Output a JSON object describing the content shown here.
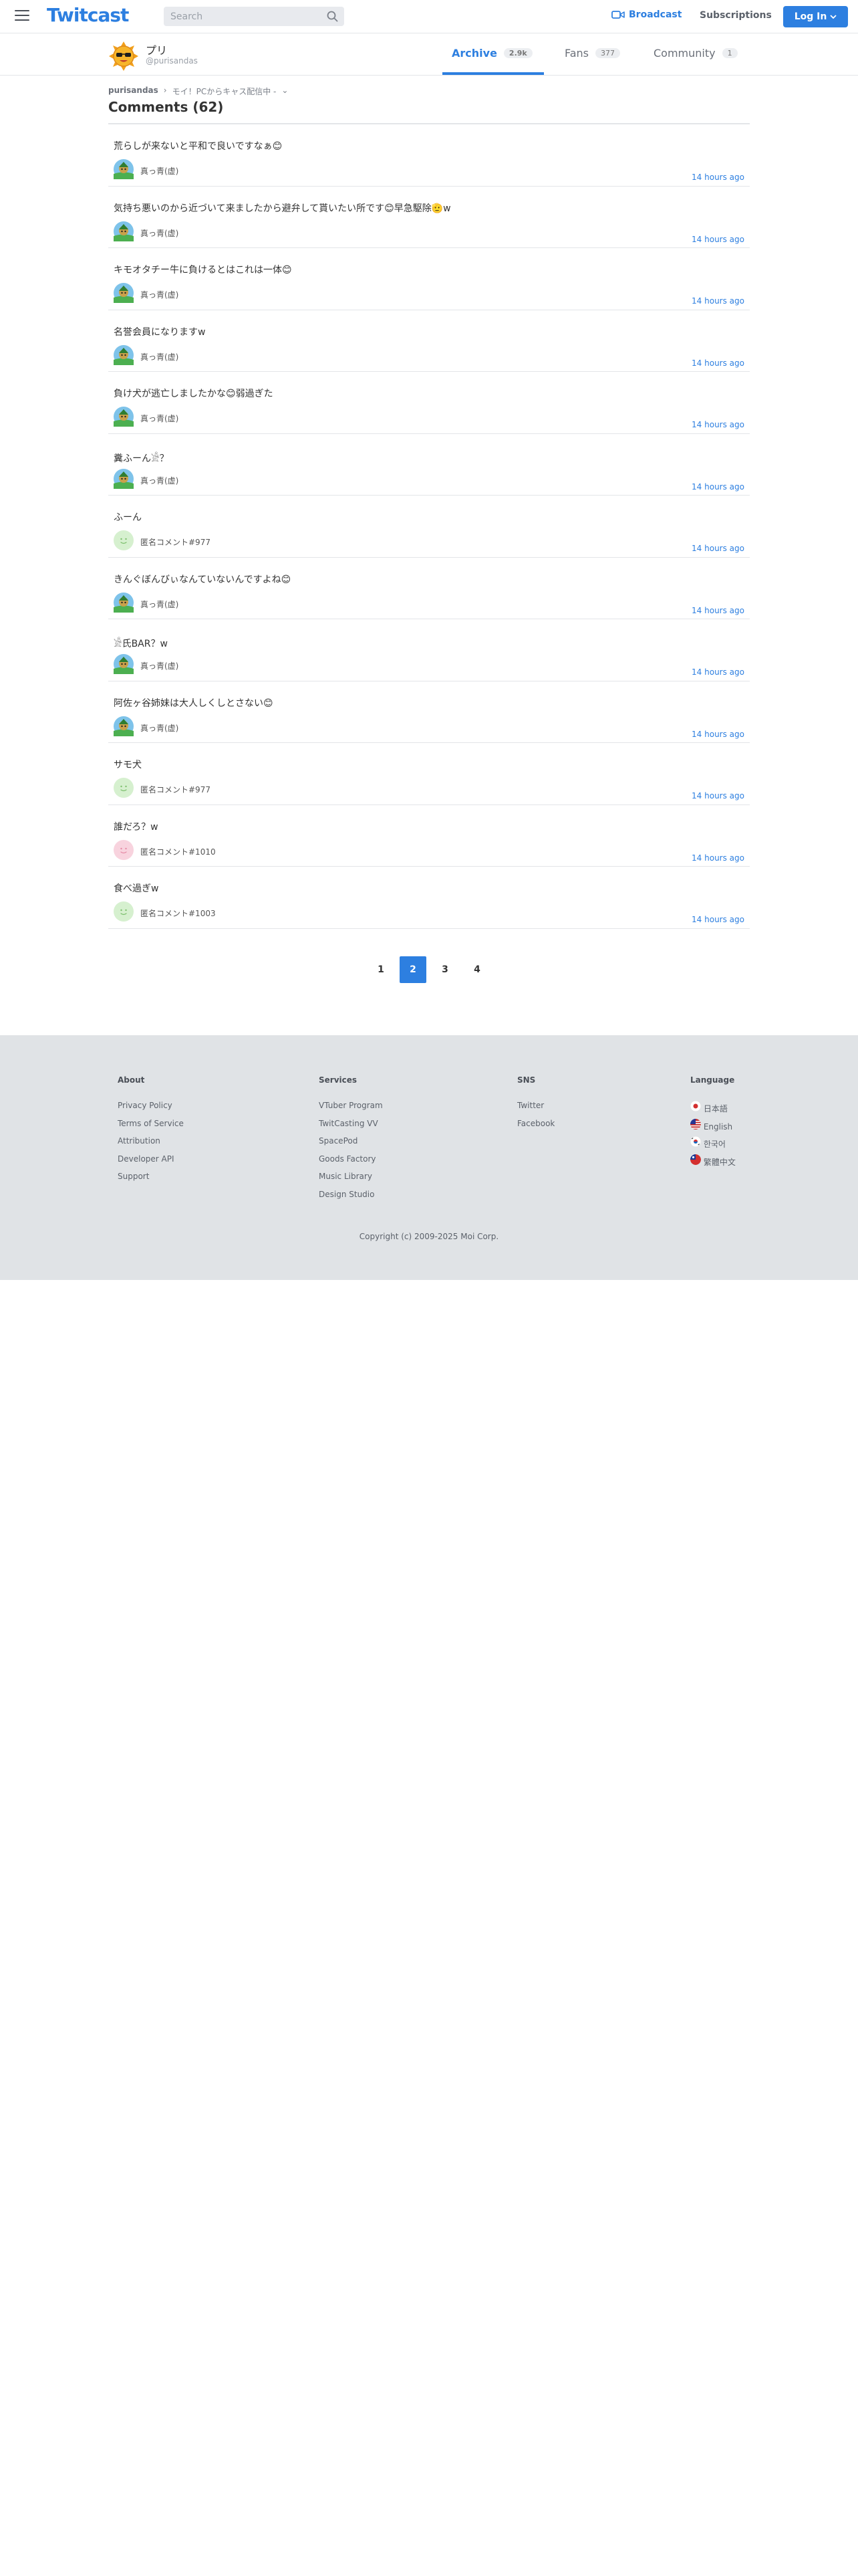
{
  "header": {
    "logo": "Twitcast",
    "search_placeholder": "Search",
    "broadcast_label": "Broadcast",
    "subscriptions_label": "Subscriptions",
    "login_label": "Log In"
  },
  "profile": {
    "name": "プリ",
    "handle": "@purisandas",
    "tabs": [
      {
        "label": "Archive",
        "count": "2.9k"
      },
      {
        "label": "Fans",
        "count": "377"
      },
      {
        "label": "Community",
        "count": "1"
      }
    ]
  },
  "breadcrumb": {
    "user": "purisandas",
    "separator": "›",
    "movie": "モイ！PCからキャス配信中 -",
    "chevron": "⌄"
  },
  "page_title": "Comments (62)",
  "comments": [
    {
      "message": "荒らしが来ないと平和で良いですなぁ😊",
      "user": "真っ青(虚)",
      "time": "14 hours ago",
      "avatar": "character"
    },
    {
      "message": "気持ち悪いのから近づいて来ましたから避弁して貰いたい所です😊早急駆除🫡w",
      "user": "真っ青(虚)",
      "time": "14 hours ago",
      "avatar": "character"
    },
    {
      "message": "キモオタチー牛に負けるとはこれは一体😊",
      "user": "真っ青(虚)",
      "time": "14 hours ago",
      "avatar": "character"
    },
    {
      "message": "名誉会員になりますw",
      "user": "真っ青(虚)",
      "time": "14 hours ago",
      "avatar": "character"
    },
    {
      "message": "負け犬が逃亡しましたかな😊弱過ぎた",
      "user": "真っ青(虚)",
      "time": "14 hours ago",
      "avatar": "character"
    },
    {
      "message": "糞ふーん𓀀？",
      "user": "真っ青(虚)",
      "time": "14 hours ago",
      "avatar": "character"
    },
    {
      "message": "ふーん",
      "user": "匿名コメント#977",
      "time": "14 hours ago",
      "avatar": "anon-green"
    },
    {
      "message": "きんぐぼんびぃなんていないんですよね😊",
      "user": "真っ青(虚)",
      "time": "14 hours ago",
      "avatar": "character"
    },
    {
      "message": "𓀀氏BAR？w",
      "user": "真っ青(虚)",
      "time": "14 hours ago",
      "avatar": "character"
    },
    {
      "message": "阿佐ヶ谷姉妹は大人しくしとさない😊",
      "user": "真っ青(虚)",
      "time": "14 hours ago",
      "avatar": "character"
    },
    {
      "message": "サモ犬",
      "user": "匿名コメント#977",
      "time": "14 hours ago",
      "avatar": "anon-green"
    },
    {
      "message": "誰だろ？w",
      "user": "匿名コメント#1010",
      "time": "14 hours ago",
      "avatar": "anon-pink"
    },
    {
      "message": "食べ過ぎw",
      "user": "匿名コメント#1003",
      "time": "14 hours ago",
      "avatar": "anon-green"
    }
  ],
  "pagination": {
    "pages": [
      "1",
      "2",
      "3",
      "4"
    ],
    "current": "2"
  },
  "footer": {
    "about": {
      "title": "About",
      "links": [
        "Privacy Policy",
        "Terms of Service",
        "Attribution",
        "Developer API",
        "Support"
      ]
    },
    "services": {
      "title": "Services",
      "links": [
        "VTuber Program",
        "TwitCasting VV",
        "SpacePod",
        "Goods Factory",
        "Music Library",
        "Design Studio"
      ]
    },
    "sns": {
      "title": "SNS",
      "links": [
        "Twitter",
        "Facebook"
      ]
    },
    "language": {
      "title": "Language",
      "links": [
        "日本語",
        "English",
        "한국어",
        "繁體中文"
      ]
    },
    "copyright": "Copyright (c) 2009-2025 Moi Corp."
  },
  "colors": {
    "accent": "#2d7fe0",
    "footer_bg": "#e0e3e6"
  }
}
